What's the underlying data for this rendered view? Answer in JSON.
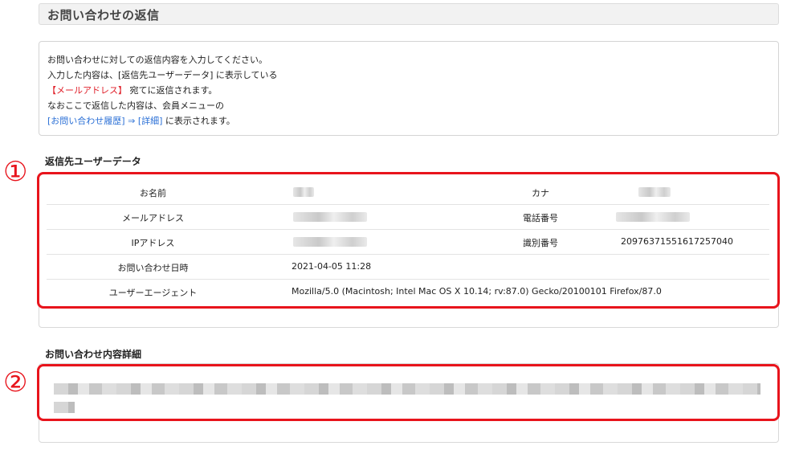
{
  "header": {
    "title": "お問い合わせの返信"
  },
  "info": {
    "line1": "お問い合わせに対しての返信内容を入力してください。",
    "line2": "入力した内容は、[返信先ユーザーデータ] に表示している",
    "line3_red": "【メールアドレス】",
    "line3_rest": " 宛てに返信されます。",
    "line4": "なおここで返信した内容は、会員メニューの",
    "line5_link1": "[お問い合わせ履歴]",
    "line5_arrow": " ⇒ ",
    "line5_link2": "[詳細]",
    "line5_rest": " に表示されます。"
  },
  "user_section": {
    "title": "返信先ユーザーデータ",
    "marker": "①",
    "rows": [
      {
        "label_l": "お名前",
        "value_l": "",
        "label_r": "カナ",
        "value_r": ""
      },
      {
        "label_l": "メールアドレス",
        "value_l": "",
        "label_r": "電話番号",
        "value_r": ""
      },
      {
        "label_l": "IPアドレス",
        "value_l": "",
        "label_r": "識別番号",
        "value_r": "20976371551617257040"
      },
      {
        "label_l": "お問い合わせ日時",
        "value_l": "2021-04-05 11:28",
        "label_r": "",
        "value_r": ""
      },
      {
        "label_l": "ユーザーエージェント",
        "value_l": "Mozilla/5.0 (Macintosh; Intel Mac OS X 10.14; rv:87.0) Gecko/20100101 Firefox/87.0",
        "label_r": "",
        "value_r": ""
      }
    ]
  },
  "detail_section": {
    "title": "お問い合わせ内容詳細",
    "marker": "②",
    "content": ""
  },
  "colors": {
    "highlight": "#e8141c",
    "link": "#2a6fd6",
    "emphasis": "#e0202a"
  }
}
